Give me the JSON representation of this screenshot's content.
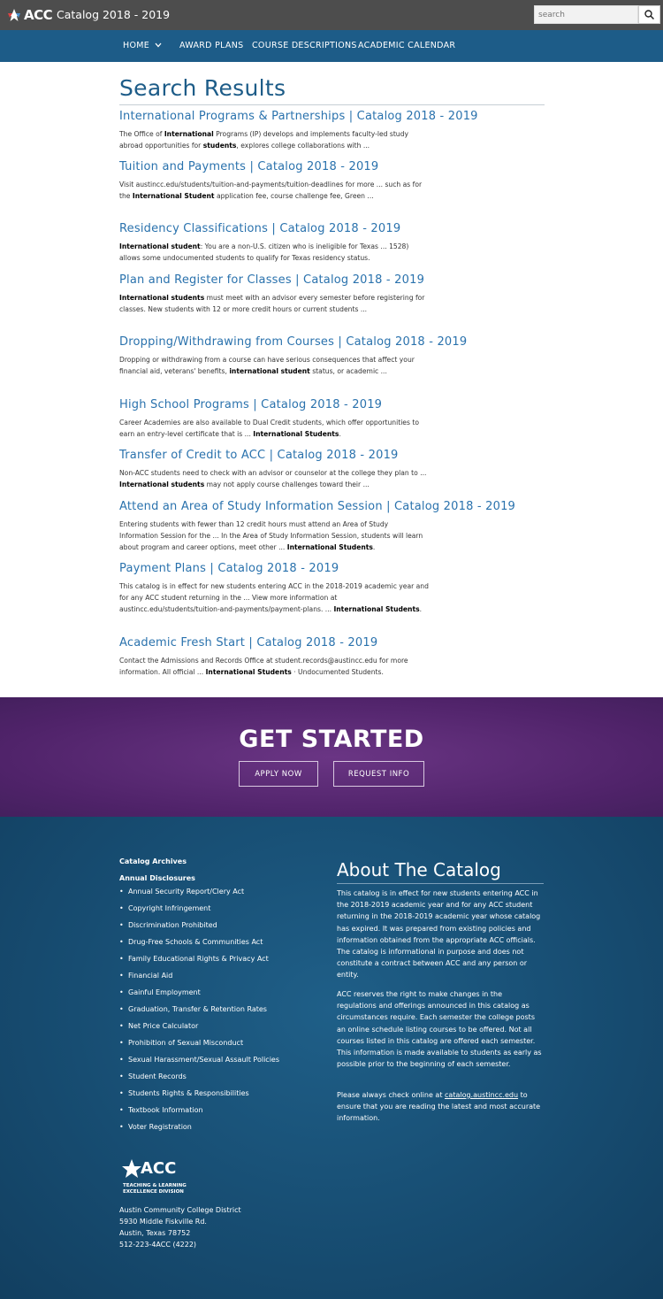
{
  "header": {
    "logo_text": "ACC",
    "site_title": "Catalog 2018 - 2019",
    "search_placeholder": "search"
  },
  "nav": {
    "items": [
      {
        "label": "HOME"
      },
      {
        "label": "AWARD PLANS"
      },
      {
        "label": "COURSE DESCRIPTIONS"
      },
      {
        "label": "ACADEMIC CALENDAR"
      }
    ]
  },
  "main": {
    "page_title": "Search Results",
    "results": [
      {
        "title": "International Programs & Partnerships | Catalog 2018 - 2019",
        "snippet": [
          {
            "t": "The Office of "
          },
          {
            "t": "International",
            "b": true
          },
          {
            "t": " Programs (IP) develops and implements faculty-led study abroad opportunities for "
          },
          {
            "t": "students",
            "b": true
          },
          {
            "t": ", explores college collaborations with ..."
          }
        ]
      },
      {
        "title": "Tuition and Payments | Catalog 2018 - 2019",
        "snippet": [
          {
            "t": "Visit austincc.edu/students/tuition-and-payments/tuition-deadlines for more ... such as for the "
          },
          {
            "t": "International Student",
            "b": true
          },
          {
            "t": " application fee, course challenge fee, Green ..."
          }
        ]
      },
      {
        "title": "Residency Classifications | Catalog 2018 - 2019",
        "snippet": [
          {
            "t": "International student",
            "b": true
          },
          {
            "t": ": You are a non-U.S. citizen who is ineligible for Texas ... 1528) allows some undocumented students to qualify for Texas residency status."
          }
        ]
      },
      {
        "title": "Plan and Register for Classes | Catalog 2018 - 2019",
        "snippet": [
          {
            "t": "International students",
            "b": true
          },
          {
            "t": " must meet with an advisor every semester before registering for classes. New students with 12 or more credit hours or current students ..."
          }
        ]
      },
      {
        "title": "Dropping/Withdrawing from Courses | Catalog 2018 - 2019",
        "snippet": [
          {
            "t": "Dropping or withdrawing from a course can have serious consequences that affect your financial aid, veterans' benefits, "
          },
          {
            "t": "international student",
            "b": true
          },
          {
            "t": " status, or academic ..."
          }
        ]
      },
      {
        "title": "High School Programs | Catalog 2018 - 2019",
        "snippet": [
          {
            "t": "Career Academies are also available to Dual Credit students, which offer opportunities to earn an entry-level certificate that is ... "
          },
          {
            "t": "International Students",
            "b": true
          },
          {
            "t": "."
          }
        ]
      },
      {
        "title": "Transfer of Credit to ACC | Catalog 2018 - 2019",
        "snippet": [
          {
            "t": "Non-ACC students need to check with an advisor or counselor at the college they plan to ... "
          },
          {
            "t": "International students",
            "b": true
          },
          {
            "t": " may not apply course challenges toward their ..."
          }
        ]
      },
      {
        "title": "Attend an Area of Study Information Session | Catalog 2018 - 2019",
        "snippet": [
          {
            "t": "Entering students with fewer than 12 credit hours must attend an Area of Study Information Session for the ... In the Area of Study Information Session, students will learn about program and career options, meet other ... "
          },
          {
            "t": "International Students",
            "b": true
          },
          {
            "t": "."
          }
        ]
      },
      {
        "title": "Payment Plans | Catalog 2018 - 2019",
        "snippet": [
          {
            "t": "This catalog is in effect for new students entering ACC in the 2018-2019 academic year and for any ACC student returning in the ... View more information at austincc.edu/students/tuition-and-payments/payment-plans. ... "
          },
          {
            "t": "International Students",
            "b": true
          },
          {
            "t": "."
          }
        ]
      },
      {
        "title": "Academic Fresh Start | Catalog 2018 - 2019",
        "snippet": [
          {
            "t": "Contact the Admissions and Records Office at student.records@austincc.edu for more information. All official ... "
          },
          {
            "t": "International Students",
            "b": true
          },
          {
            "t": " · Undocumented Students."
          }
        ]
      }
    ]
  },
  "get_started": {
    "title": "GET STARTED",
    "apply_label": "APPLY NOW",
    "request_label": "REQUEST INFO"
  },
  "footer": {
    "catalog_archives": "Catalog Archives",
    "annual_disclosures": "Annual Disclosures",
    "links": [
      "Annual Security Report/Clery Act",
      "Copyright Infringement",
      "Discrimination Prohibited",
      "Drug-Free Schools & Communities Act",
      "Family Educational Rights & Privacy Act",
      "Financial Aid",
      "Gainful Employment",
      "Graduation, Transfer & Retention Rates",
      "Net Price Calculator",
      "Prohibition of Sexual Misconduct",
      "Sexual Harassment/Sexual Assault Policies",
      "Student Records",
      "Students Rights & Responsibilities",
      "Textbook Information",
      "Voter Registration"
    ],
    "about_title": "About The Catalog",
    "about_p1": "This catalog is in effect for new students entering ACC in the 2018-2019 academic year and for any ACC student returning in the 2018-2019 academic year whose catalog has expired. It was prepared from existing policies and information obtained from the appropriate ACC officials. The catalog is informational in purpose and does not constitute a contract between ACC and any person or entity.",
    "about_p2": "ACC reserves the right to make changes in the regulations and offerings announced in this catalog as circumstances require. Each semester the college posts an online schedule listing courses to be offered. Not all courses listed in this catalog are offered each semester. This information is made available to students as early as possible prior to the beginning of each semester.",
    "about_p3_before": "Please always check online at ",
    "about_p3_link": "catalog.austincc.edu",
    "about_p3_after": " to ensure that you are reading the latest and most accurate information.",
    "logo_text": "ACC",
    "logo_sub1": "TEACHING & LEARNING",
    "logo_sub2": "EXCELLENCE DIVISION",
    "address": [
      "Austin Community College District",
      "5930 Middle Fiskville Rd.",
      "Austin, Texas 78752",
      "512-223-4ACC (4222)"
    ]
  },
  "colors": {
    "topbar": "#4d4d4d",
    "nav": "#1d5c88",
    "link": "#2a72ad",
    "purple": "#50236a",
    "footer": "#174d72"
  }
}
